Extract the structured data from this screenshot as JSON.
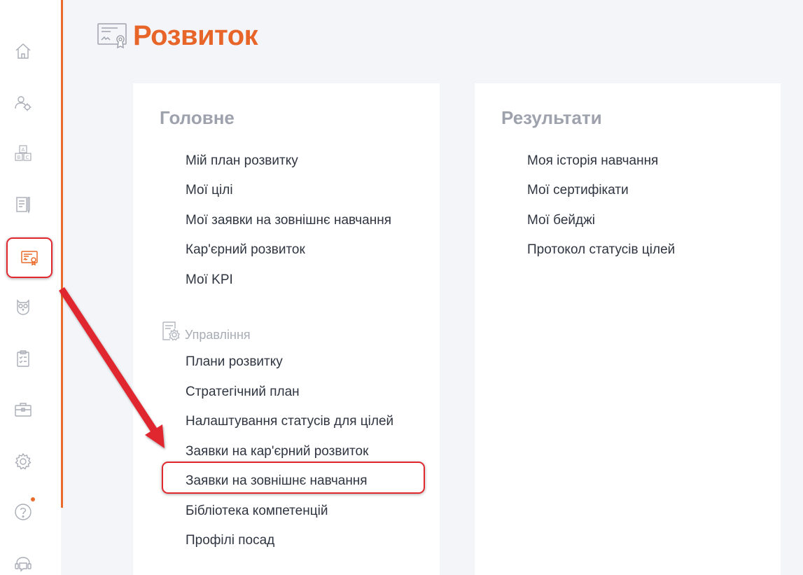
{
  "header": {
    "title": "Розвиток",
    "icon": "certificate-icon"
  },
  "sidebar": {
    "items": [
      {
        "icon": "home-icon"
      },
      {
        "icon": "people-settings-icon"
      },
      {
        "icon": "abc-blocks-icon"
      },
      {
        "icon": "notebook-pen-icon"
      },
      {
        "icon": "certificate-icon",
        "active": true
      },
      {
        "icon": "owl-icon"
      },
      {
        "icon": "clipboard-icon"
      },
      {
        "icon": "briefcase-icon"
      },
      {
        "icon": "gear-icon"
      },
      {
        "icon": "help-icon",
        "notification": true
      },
      {
        "icon": "support-chat-icon"
      }
    ],
    "accent_color": "#ea6b2b"
  },
  "main": {
    "heading": "Головне",
    "links": [
      "Мій план розвитку",
      "Мої цілі",
      "Мої заявки на зовнішнє навчання",
      "Кар'єрний розвиток",
      "Мої KPI"
    ],
    "management": {
      "heading": "Управління",
      "icon": "document-gear-icon",
      "links": [
        "Плани розвитку",
        "Стратегічний план",
        "Налаштування статусів для цілей",
        "Заявки на кар'єрний розвиток",
        "Заявки на зовнішнє навчання",
        "Бібліотека компетенцій",
        "Профілі посад"
      ]
    }
  },
  "results": {
    "heading": "Результати",
    "links": [
      "Моя історія навчання",
      "Мої сертифікати",
      "Мої бейджі",
      "Протокол статусів цілей"
    ]
  },
  "colors": {
    "brand": "#e8652a",
    "highlight": "#e0282e",
    "heading": "#9ea2ad",
    "background": "#f4f5f8"
  }
}
